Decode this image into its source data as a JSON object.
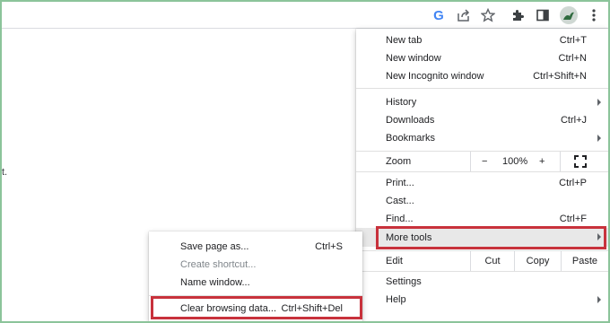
{
  "toolbar": {
    "google_letter": "G",
    "icons": [
      "google-lens-icon",
      "share-icon",
      "bookmark-star-icon",
      "extensions-icon",
      "side-panel-icon",
      "profile-avatar",
      "kebab-menu-icon"
    ]
  },
  "page": {
    "visible_text": "t."
  },
  "main_menu": {
    "new_tab": {
      "label": "New tab",
      "shortcut": "Ctrl+T"
    },
    "new_window": {
      "label": "New window",
      "shortcut": "Ctrl+N"
    },
    "new_incognito": {
      "label": "New Incognito window",
      "shortcut": "Ctrl+Shift+N"
    },
    "history": {
      "label": "History"
    },
    "downloads": {
      "label": "Downloads",
      "shortcut": "Ctrl+J"
    },
    "bookmarks": {
      "label": "Bookmarks"
    },
    "zoom": {
      "label": "Zoom",
      "minus": "−",
      "value": "100%",
      "plus": "+"
    },
    "print": {
      "label": "Print...",
      "shortcut": "Ctrl+P"
    },
    "cast": {
      "label": "Cast..."
    },
    "find": {
      "label": "Find...",
      "shortcut": "Ctrl+F"
    },
    "more_tools": {
      "label": "More tools"
    },
    "edit": {
      "label": "Edit",
      "cut": "Cut",
      "copy": "Copy",
      "paste": "Paste"
    },
    "settings": {
      "label": "Settings"
    },
    "help": {
      "label": "Help"
    }
  },
  "sub_menu": {
    "save_page": {
      "label": "Save page as...",
      "shortcut": "Ctrl+S"
    },
    "create_shortcut": {
      "label": "Create shortcut..."
    },
    "name_window": {
      "label": "Name window..."
    },
    "clear_browsing": {
      "label": "Clear browsing data...",
      "shortcut": "Ctrl+Shift+Del"
    }
  },
  "colors": {
    "highlight_border": "#c8323c",
    "frame_border": "#8cc49a",
    "hover_bg": "#e8e8e8"
  }
}
